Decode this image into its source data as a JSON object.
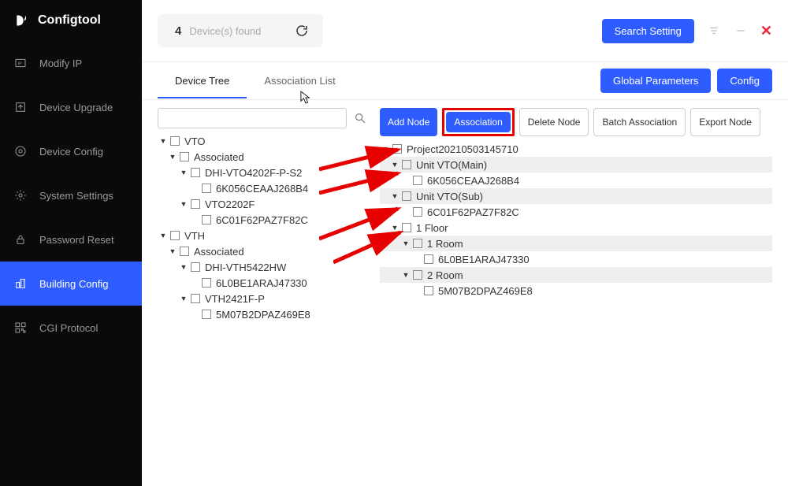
{
  "app": {
    "title": "Configtool"
  },
  "sidebar": {
    "items": [
      {
        "label": "Modify IP"
      },
      {
        "label": "Device Upgrade"
      },
      {
        "label": "Device Config"
      },
      {
        "label": "System Settings"
      },
      {
        "label": "Password Reset"
      },
      {
        "label": "Building Config"
      },
      {
        "label": "CGI Protocol"
      }
    ]
  },
  "topbar": {
    "count": "4",
    "found_label": "Device(s) found",
    "search_setting": "Search Setting"
  },
  "tabs": {
    "items": [
      {
        "label": "Device Tree"
      },
      {
        "label": "Association List"
      }
    ],
    "global_parameters": "Global Parameters",
    "config": "Config"
  },
  "toolbar": {
    "add_node": "Add Node",
    "association": "Association",
    "delete_node": "Delete Node",
    "batch_association": "Batch Association",
    "export_node": "Export Node"
  },
  "search": {
    "placeholder": ""
  },
  "tree_left": {
    "n0": "VTO",
    "n0_0": "Associated",
    "n0_0_0": "DHI-VTO4202F-P-S2",
    "n0_0_0_0": "6K056CEAAJ268B4",
    "n0_0_1": "VTO2202F",
    "n0_0_1_0": "6C01F62PAZ7F82C",
    "n1": "VTH",
    "n1_0": "Associated",
    "n1_0_0": "DHI-VTH5422HW",
    "n1_0_0_0": "6L0BE1ARAJ47330",
    "n1_0_1": "VTH2421F-P",
    "n1_0_1_0": "5M07B2DPAZ469E8"
  },
  "tree_right": {
    "r0": "Project20210503145710",
    "r0_0": "Unit VTO(Main)",
    "r0_0_0": "6K056CEAAJ268B4",
    "r0_1": "Unit VTO(Sub)",
    "r0_1_0": "6C01F62PAZ7F82C",
    "r0_2": "1 Floor",
    "r0_2_0": "1 Room",
    "r0_2_0_0": "6L0BE1ARAJ47330",
    "r0_2_1": "2 Room",
    "r0_2_1_0": "5M07B2DPAZ469E8"
  }
}
